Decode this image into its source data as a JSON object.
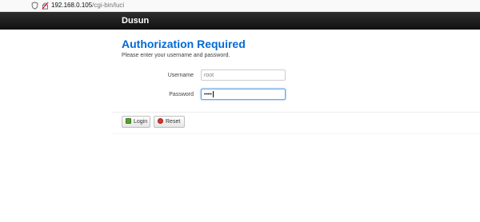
{
  "browser": {
    "url_host": "192.168.0.105",
    "url_path": "/cgi-bin/luci"
  },
  "header": {
    "brand": "Dusun"
  },
  "main": {
    "title": "Authorization Required",
    "subtitle": "Please enter your username and password."
  },
  "form": {
    "username_label": "Username",
    "username_value": "root",
    "password_label": "Password",
    "password_masked": "••••"
  },
  "actions": {
    "login_label": "Login",
    "reset_label": "Reset"
  },
  "colors": {
    "title": "#0069d6",
    "header_bg": "#1a1a1a",
    "login_icon": "#5aa02c",
    "reset_icon": "#d9352a"
  }
}
